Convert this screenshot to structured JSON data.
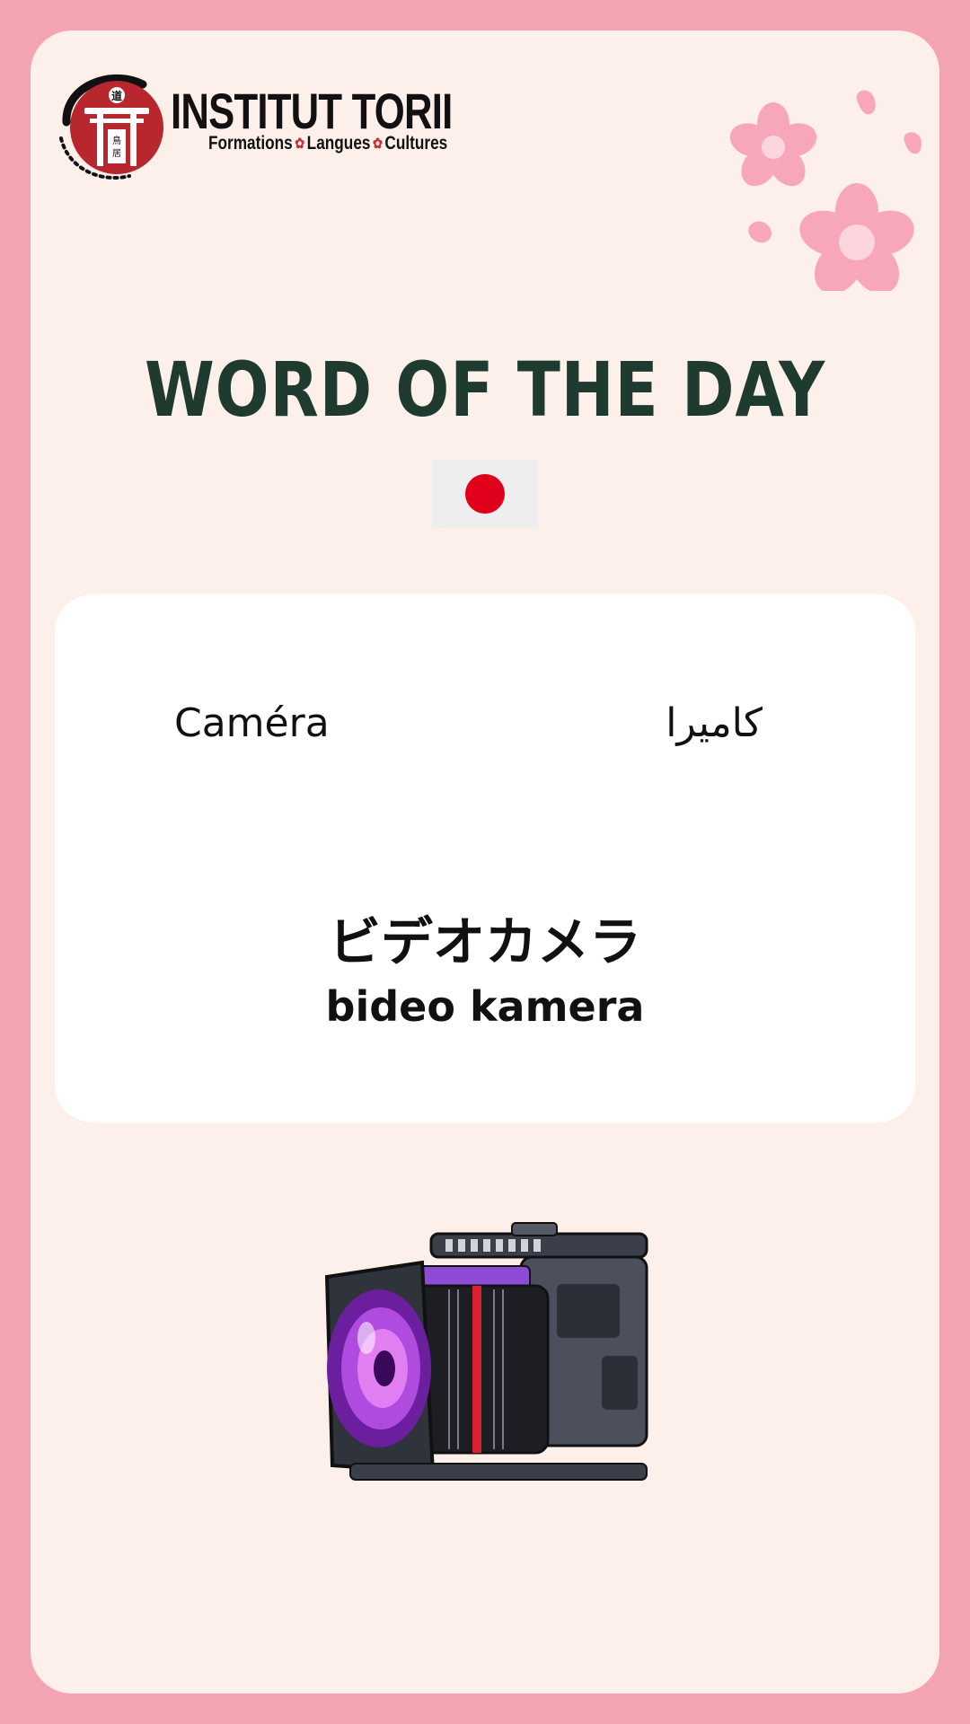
{
  "logo": {
    "brand": "INSTITUT TORII",
    "tagline_parts": [
      "Formations",
      "Langues",
      "Cultures"
    ],
    "emblem_top_char": "道",
    "emblem_side_text": "鳥居"
  },
  "title": "Word of the day",
  "flag": "japan-flag",
  "card": {
    "french": "Caméra",
    "arabic": "كاميرا",
    "japanese": "ビデオカメラ",
    "romaji": "bideo kamera"
  },
  "colors": {
    "border_pink": "#f4a3b2",
    "background_cream": "#fdf0ea",
    "title_green": "#1f3a2e",
    "flag_red": "#e0001b",
    "logo_red": "#b8262e"
  }
}
